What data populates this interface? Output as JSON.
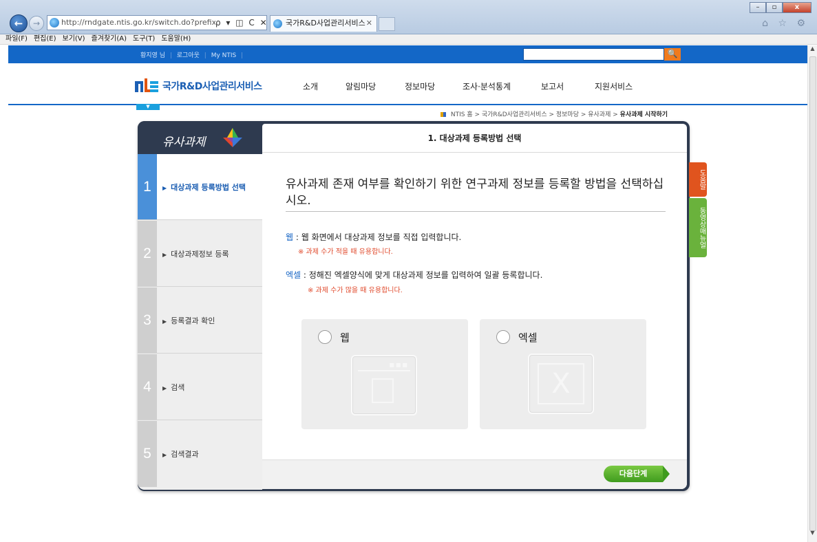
{
  "browser": {
    "address": "http://rndgate.ntis.go.kr/switch.do?prefix=/ia/exRelat",
    "address_host": "ntis.go.kr",
    "address_tools": "ρ ▾ ◫ C ✕",
    "tab_title": "국가R&D사업관리서비스",
    "tab_close": "✕",
    "menu": [
      "파일(F)",
      "편집(E)",
      "보기(V)",
      "즐겨찾기(A)",
      "도구(T)",
      "도움말(H)"
    ],
    "win_min": "–",
    "win_max": "▫",
    "win_close": "x",
    "back_icon": "←",
    "fwd_icon": "→",
    "fav_icons": "⌂ ☆ ⚙"
  },
  "site": {
    "user_name": "황지영 님",
    "logout": "로그아웃",
    "my_ntis": "My NTIS",
    "search_placeholder": "",
    "search_icon": "🔍",
    "logo_text": "국가R&D사업관리서비스",
    "nav": [
      "소개",
      "알림마당",
      "정보마당",
      "조사·분석통계",
      "보고서",
      "지원서비스"
    ],
    "nav_toggle": "▼",
    "breadcrumb_prefix": "NTIS 홈 > 국가R&D사업관리서비스 > 정보마당 > 유사과제 >",
    "breadcrumb_current": "유사과제 시작하기"
  },
  "wizard": {
    "brand": "유사과제",
    "steps": [
      {
        "num": "1",
        "label": "대상과제 등록방법 선택"
      },
      {
        "num": "2",
        "label": "대상과제정보 등록"
      },
      {
        "num": "3",
        "label": "등록결과 확인"
      },
      {
        "num": "4",
        "label": "검색"
      },
      {
        "num": "5",
        "label": "검색결과"
      }
    ],
    "header": "1. 대상과제 등록방법 선택",
    "heading": "유사과제 존재 여부를 확인하기 위한 연구과제 정보를 등록할 방법을 선택하십시오.",
    "web_key": "웹",
    "web_desc": " : 웹 화면에서 대상과제 정보를 직접 입력합니다.",
    "web_note": "※ 과제 수가 적을 때 유용합니다.",
    "excel_key": "엑셀",
    "excel_desc": " : 정해진 엑셀양식에 맞게 대상과제 정보를 입력하여 일괄 등록합니다.",
    "excel_note": "※ 과제 수가 많을 때 유용합니다.",
    "choice_web": "웹",
    "choice_excel": "엑셀",
    "next": "다음단계",
    "help_tab": "도움말",
    "video_tab": "동영상매뉴얼"
  },
  "colors": {
    "brand_blue": "#1367c7",
    "active_step": "#4a90d9",
    "note_red": "#e04a2c",
    "next_green": "#4caf2a"
  }
}
